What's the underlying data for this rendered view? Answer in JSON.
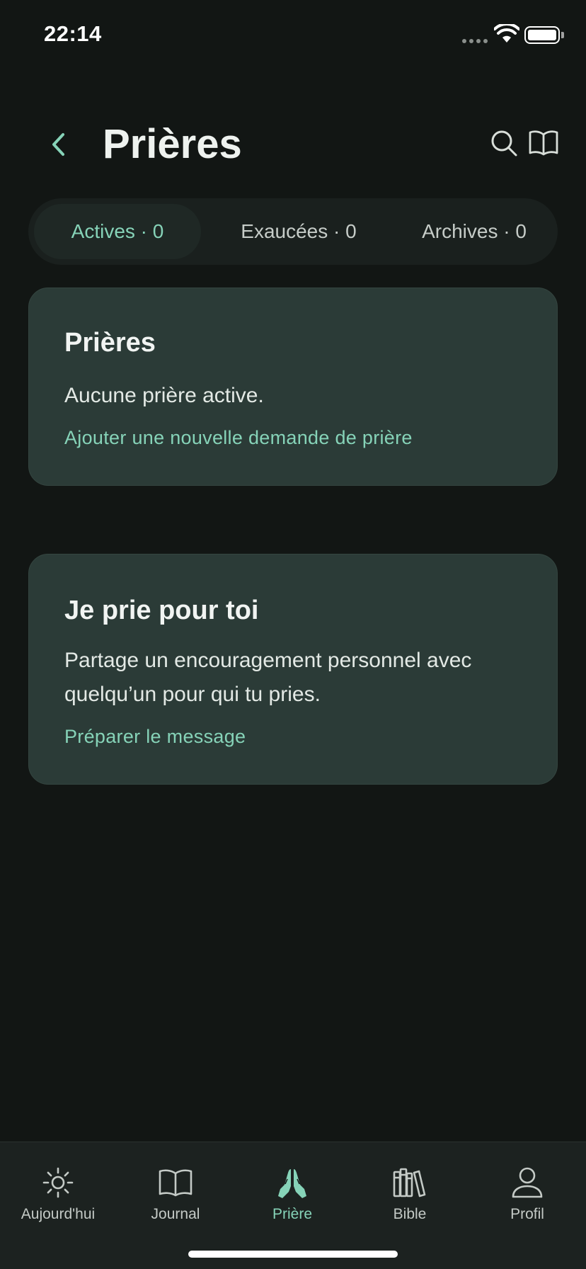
{
  "status_bar": {
    "time": "22:14"
  },
  "header": {
    "title": "Prières",
    "back_icon": "chevron-left-icon",
    "actions": [
      "search-icon",
      "book-open-icon"
    ]
  },
  "tabs": [
    {
      "label": "Actives · 0",
      "active": true
    },
    {
      "label": "Exaucées · 0",
      "active": false
    },
    {
      "label": "Archives · 0",
      "active": false
    }
  ],
  "cards": [
    {
      "title": "Prières",
      "body": "Aucune prière active.",
      "link": "Ajouter une nouvelle demande de prière"
    },
    {
      "title": "Je prie pour toi",
      "body": "Partage un encouragement personnel avec quelqu’un pour qui tu pries.",
      "link": "Préparer le message"
    }
  ],
  "bottom_nav": [
    {
      "label": "Aujourd'hui",
      "icon": "sun-icon",
      "active": false
    },
    {
      "label": "Journal",
      "icon": "book-open-icon",
      "active": false
    },
    {
      "label": "Prière",
      "icon": "praying-hands-icon",
      "active": true
    },
    {
      "label": "Bible",
      "icon": "library-books-icon",
      "active": false
    },
    {
      "label": "Profil",
      "icon": "person-icon",
      "active": false
    }
  ],
  "colors": {
    "background": "#121614",
    "card": "#2b3b37",
    "accent": "#86d3b8",
    "text": "#eef2ef"
  }
}
